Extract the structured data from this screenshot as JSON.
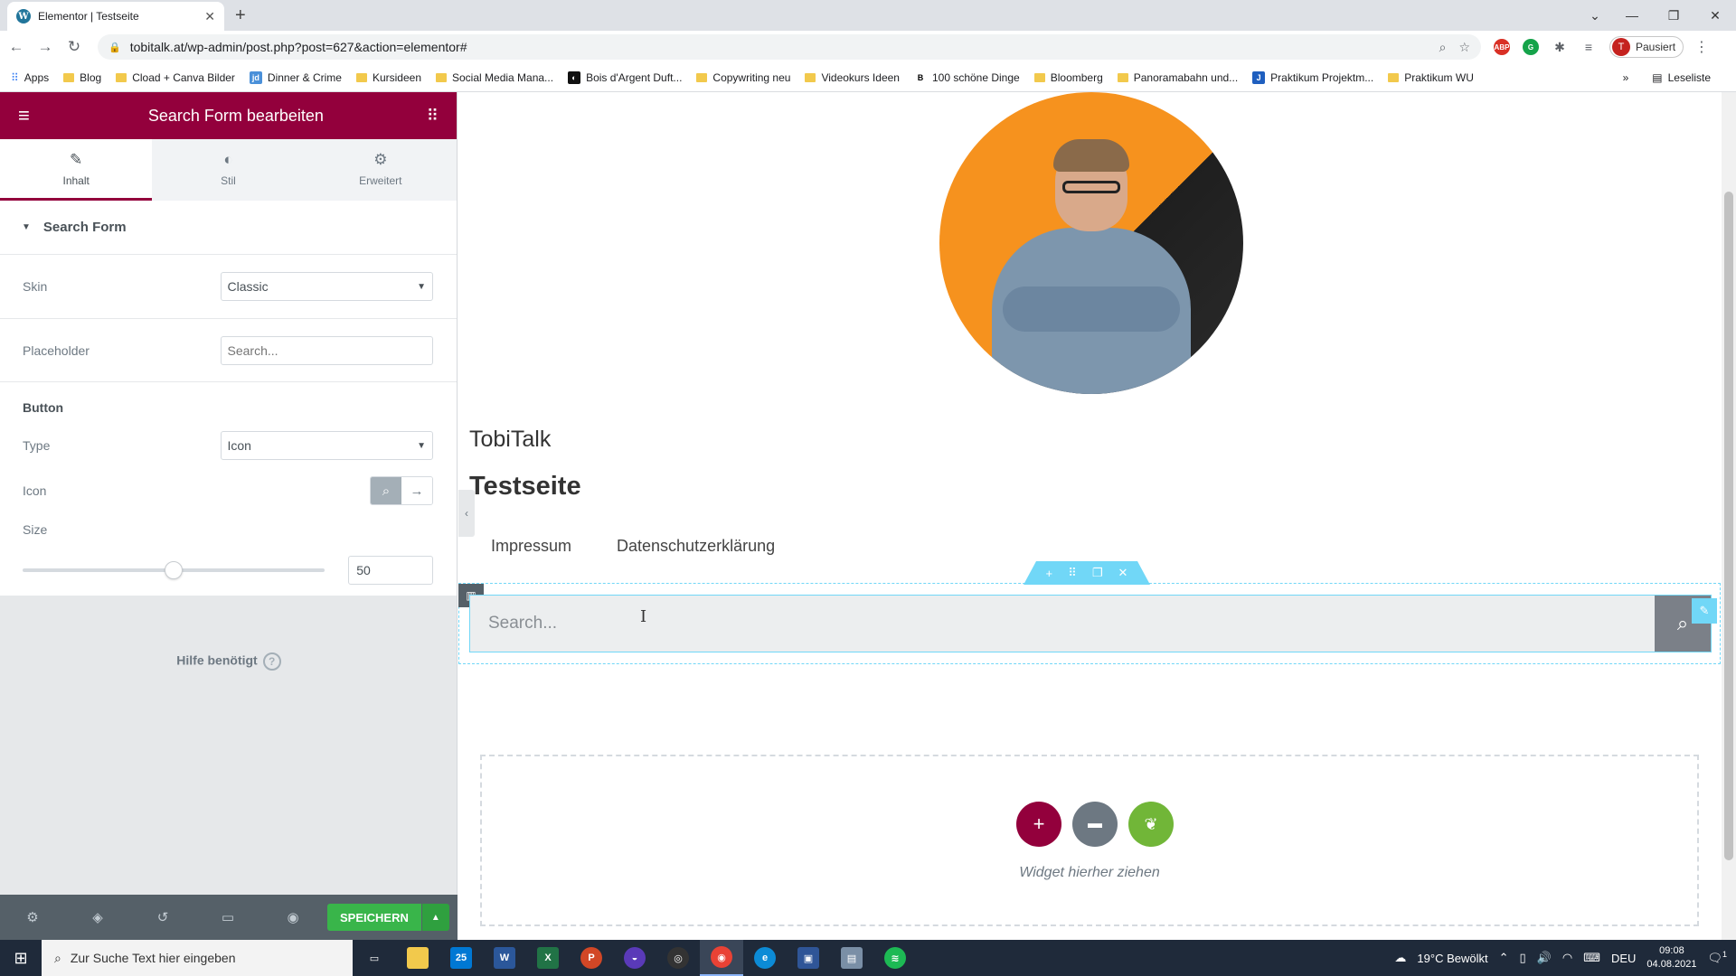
{
  "browser": {
    "tab_title": "Elementor | Testseite",
    "tab_icon": "W",
    "url": "tobitalk.at/wp-admin/post.php?post=627&action=elementor#",
    "profile_initial": "T",
    "profile_label": "Pausiert",
    "bookmarks": [
      "Apps",
      "Blog",
      "Cload + Canva Bilder",
      "Dinner & Crime",
      "Kursideen",
      "Social Media Mana...",
      "Bois d'Argent Duft...",
      "Copywriting neu",
      "Videokurs Ideen",
      "100 schöne Dinge",
      "Bloomberg",
      "Panoramabahn und...",
      "Praktikum Projektm...",
      "Praktikum WU"
    ],
    "bookmark_icons": {
      "dinner": "jd",
      "bois": "◐",
      "schoene": "B",
      "projekt": "J"
    },
    "more": "»",
    "reading_list": "Leseliste"
  },
  "panel": {
    "title": "Search Form bearbeiten",
    "tabs": [
      {
        "label": "Inhalt",
        "icon": "✎"
      },
      {
        "label": "Stil",
        "icon": "◐"
      },
      {
        "label": "Erweitert",
        "icon": "⚙"
      }
    ],
    "section_title": "Search Form",
    "skin_label": "Skin",
    "skin_value": "Classic",
    "placeholder_label": "Placeholder",
    "placeholder_value": "Search...",
    "button_heading": "Button",
    "type_label": "Type",
    "type_value": "Icon",
    "icon_label": "Icon",
    "size_label": "Size",
    "size_value": "50",
    "size_fraction": 0.5,
    "help": "Hilfe benötigt",
    "help_icon": "?",
    "save": "SPEICHERN",
    "accent": "#93003c",
    "save_color": "#39b54a"
  },
  "preview": {
    "site_title": "TobiTalk",
    "page_title": "Testseite",
    "menu": [
      "Impressum",
      "Datenschutzerklärung"
    ],
    "search_placeholder": "Search...",
    "cursor": "I",
    "dropzone_text": "Widget hierher ziehen",
    "handle_color": "#71d7f7"
  },
  "taskbar": {
    "search": "Zur Suche Text hier eingeben",
    "mail_badge": "25",
    "weather": "19°C  Bewölkt",
    "lang": "DEU",
    "time": "09:08",
    "date": "04.08.2021",
    "notifications": "1"
  }
}
